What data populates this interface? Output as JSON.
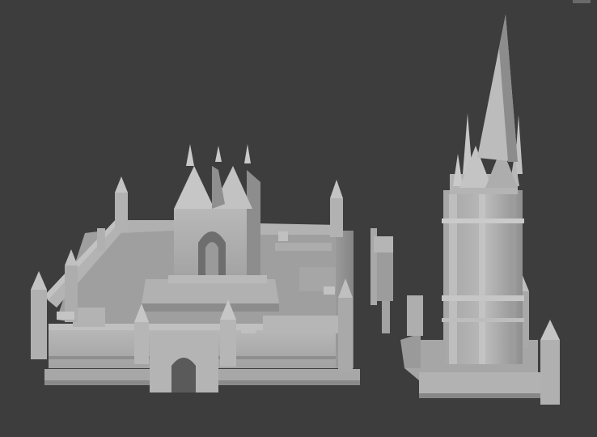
{
  "viewport": {
    "background_color": "#3d3d3d",
    "model_color": "#a9a9a9",
    "shadow_color": "#7e7e7e",
    "highlight_color": "#c9c9c9"
  },
  "scene": {
    "objects": [
      {
        "name": "castle-courtyard-complex"
      },
      {
        "name": "gothic-chapel"
      },
      {
        "name": "spired-bell-tower"
      }
    ]
  }
}
